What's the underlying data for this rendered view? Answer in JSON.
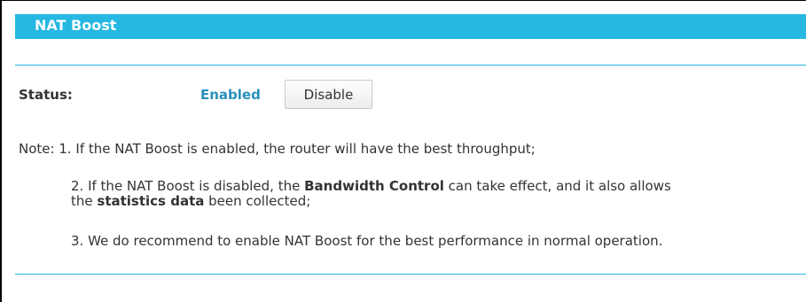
{
  "header": {
    "title": "NAT Boost"
  },
  "status": {
    "label": "Status:",
    "value": "Enabled",
    "button_label": "Disable"
  },
  "notes": {
    "line1": "Note: 1. If the NAT Boost is enabled, the router will have the best throughput;",
    "line2_pre": "2. If the NAT Boost is disabled, the ",
    "line2_bold1": "Bandwidth Control",
    "line2_post": " can take effect, and it also allows",
    "line2b_pre": "the ",
    "line2b_bold": "statistics data",
    "line2b_post": " been collected;",
    "line3": "3. We do recommend to enable NAT Boost for the best performance in normal operation."
  },
  "colors": {
    "accent": "#26b7e2",
    "status_enabled": "#2a8fbd"
  }
}
